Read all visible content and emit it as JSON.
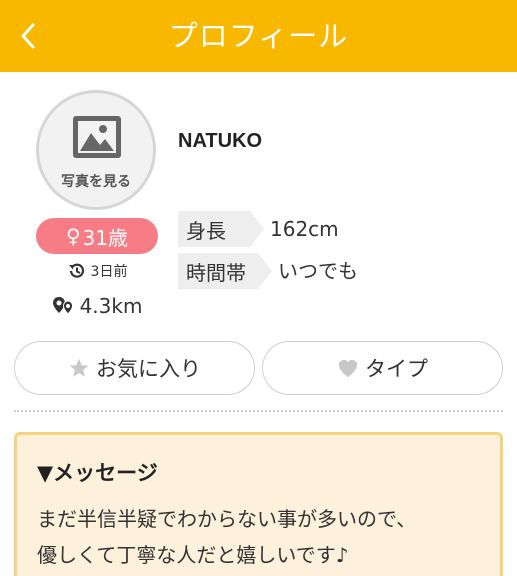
{
  "header": {
    "title": "プロフィール",
    "accent_color": "#f8b800"
  },
  "profile": {
    "photo_label": "写真を見る",
    "username": "NATUKO",
    "gender_symbol": "♀",
    "age": "31歳",
    "last_login": "3日前",
    "distance": "4.3km"
  },
  "attributes": [
    {
      "label": "身長",
      "value": "162cm"
    },
    {
      "label": "時間帯",
      "value": "いつでも"
    }
  ],
  "actions": {
    "favorite_label": "お気に入り",
    "type_label": "タイプ"
  },
  "message": {
    "title": "▼メッセージ",
    "line1": "まだ半信半疑でわからない事が多いので、",
    "line2": "優しくて丁寧な人だと嬉しいです♪"
  }
}
